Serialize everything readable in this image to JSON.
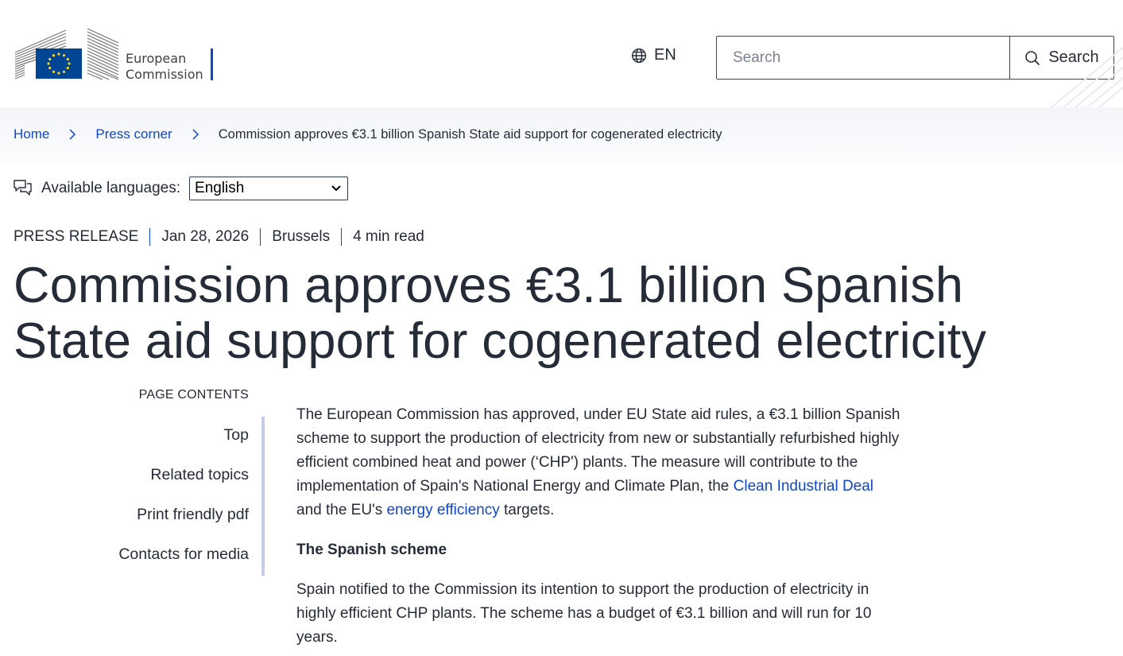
{
  "header": {
    "logo_line1": "European",
    "logo_line2": "Commission",
    "language_code": "EN",
    "search_placeholder": "Search",
    "search_button_label": "Search"
  },
  "breadcrumb": {
    "items": [
      "Home",
      "Press corner"
    ],
    "current": "Commission approves €3.1 billion Spanish State aid support for cogenerated electricity"
  },
  "languages": {
    "label": "Available languages:",
    "selected": "English"
  },
  "meta": {
    "type": "PRESS RELEASE",
    "date": "Jan 28, 2026",
    "location": "Brussels",
    "read_time": "4 min read"
  },
  "title": {
    "line1": "Commission approves €3.1 billion Spanish",
    "line2": "State aid support for cogenerated electricity"
  },
  "page_contents": {
    "heading": "PAGE CONTENTS",
    "items": [
      "Top",
      "Related topics",
      "Print friendly pdf",
      "Contacts for media"
    ]
  },
  "article": {
    "p1_line1": "The European Commission has approved, under EU State aid rules, a €3.1 billion Spanish",
    "p1_line2": "scheme to support the production of electricity from new or substantially refurbished highly",
    "p1_line3": "efficient combined heat and power (‘CHP') plants. The measure will contribute to the",
    "p1_line4_text": "implementation of Spain's National Energy and Climate Plan, the ",
    "p1_link1": "Clean Industrial Deal",
    "p1_line5_text_a": "and the EU's ",
    "p1_link2": "energy efficiency",
    "p1_line5_text_b": " targets.",
    "h_scheme": "The Spanish scheme",
    "p2_line1": "Spain notified to the Commission its intention to support the production of electricity in",
    "p2_line2": "highly efficient CHP plants. The scheme has a budget of €3.1 billion and will run for 10",
    "p2_line3": "years."
  },
  "colors": {
    "link": "#0e47cb",
    "text": "#262b38",
    "eu_blue": "#004494",
    "eu_yellow": "#ffd617",
    "toc_border": "#c5cbea"
  }
}
